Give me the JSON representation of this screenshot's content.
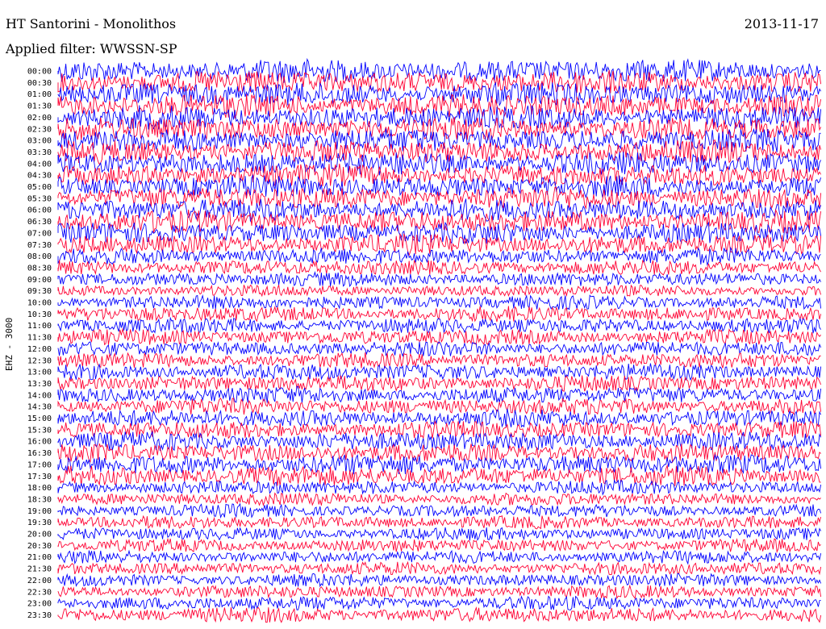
{
  "header": {
    "station": "HT Santorini - Monolithos",
    "date": "2013-11-17",
    "filter": "Applied filter: WWSSN-SP"
  },
  "chart_data": {
    "type": "line",
    "title": "HT Santorini - Monolithos",
    "subtitle": "Applied filter: WWSSN-SP",
    "date": "2013-11-17",
    "ylabel": "EHZ - 3000",
    "row_labels": [
      "00:00",
      "00:30",
      "01:00",
      "01:30",
      "02:00",
      "02:30",
      "03:00",
      "03:30",
      "04:00",
      "04:30",
      "05:00",
      "05:30",
      "06:00",
      "06:30",
      "07:00",
      "07:30",
      "08:00",
      "08:30",
      "09:00",
      "09:30",
      "10:00",
      "10:30",
      "11:00",
      "11:30",
      "12:00",
      "12:30",
      "13:00",
      "13:30",
      "14:00",
      "14:30",
      "15:00",
      "15:30",
      "16:00",
      "16:30",
      "17:00",
      "17:30",
      "18:00",
      "18:30",
      "19:00",
      "19:30",
      "20:00",
      "20:30",
      "21:00",
      "21:30",
      "22:00",
      "22:30",
      "23:00",
      "23:30"
    ],
    "row_colors": [
      "#0000ff",
      "#ff0033"
    ],
    "relative_amplitude": [
      1.0,
      1.0,
      1.0,
      1.0,
      1.0,
      1.0,
      1.0,
      1.0,
      1.0,
      0.95,
      0.95,
      0.95,
      0.95,
      0.95,
      0.9,
      0.85,
      0.7,
      0.65,
      0.6,
      0.5,
      0.6,
      0.65,
      0.65,
      0.65,
      0.65,
      0.65,
      0.7,
      0.7,
      0.7,
      0.7,
      0.75,
      0.75,
      0.8,
      0.8,
      0.85,
      0.85,
      0.6,
      0.55,
      0.55,
      0.55,
      0.55,
      0.55,
      0.55,
      0.55,
      0.55,
      0.55,
      0.6,
      0.65
    ],
    "grid": false
  }
}
